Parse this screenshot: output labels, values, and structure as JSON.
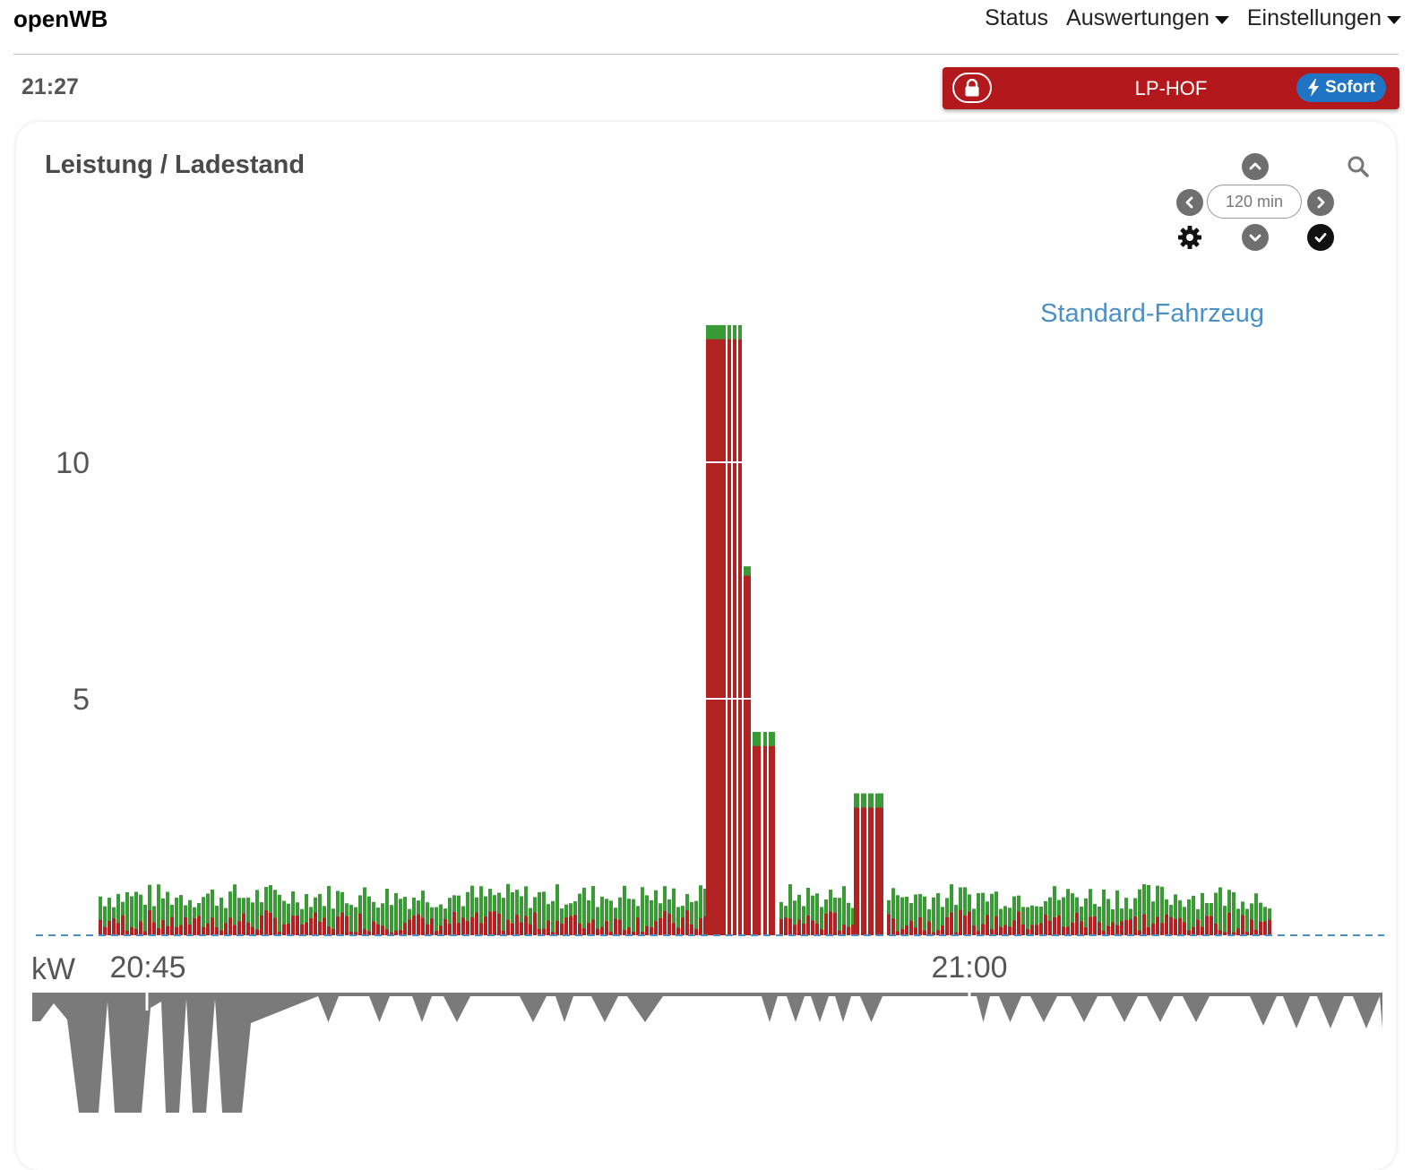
{
  "navbar": {
    "brand": "openWB",
    "links": [
      {
        "label": "Status",
        "dropdown": false
      },
      {
        "label": "Auswertungen",
        "dropdown": true
      },
      {
        "label": "Einstellungen",
        "dropdown": true
      }
    ]
  },
  "header": {
    "time": "21:27"
  },
  "chargepoint": {
    "name": "LP-HOF",
    "locked": true,
    "mode_label": "Sofort",
    "bar_color": "#b3191c",
    "mode_color": "#1f74c3"
  },
  "graph_card": {
    "title": "Leistung / Ladestand",
    "range_label": "120 min",
    "icons": [
      "chevron-up-icon",
      "chevron-down-icon",
      "chevron-left-icon",
      "chevron-right-icon",
      "gear-icon",
      "check-icon",
      "search-icon"
    ]
  },
  "chart_data": {
    "type": "area",
    "legend": [
      {
        "label": "Standard-Fahrzeug",
        "color": "#4a90c4",
        "position": "top-right"
      }
    ],
    "y_unit": "kW",
    "y_ticks": [
      5,
      10
    ],
    "ylim": [
      0,
      13
    ],
    "x_ticks": [
      "20:45",
      "21:00"
    ],
    "series": [
      {
        "name": "",
        "color": "#b22222"
      },
      {
        "name": "",
        "color": "#3a9a35"
      }
    ],
    "bottom_series_color": "#7a7a7a",
    "peaks_kw": [
      {
        "time": "20:56",
        "total": 12.9,
        "charge": 12.6
      },
      {
        "time": "20:57",
        "total": 7.8,
        "charge": 7.6
      },
      {
        "time": "20:57",
        "total": 4.3,
        "charge": 4.0
      },
      {
        "time": "20:59",
        "total": 3.0,
        "charge": 2.7
      }
    ],
    "baseline_kw": {
      "total": 1.0,
      "charge": 0.4
    }
  }
}
